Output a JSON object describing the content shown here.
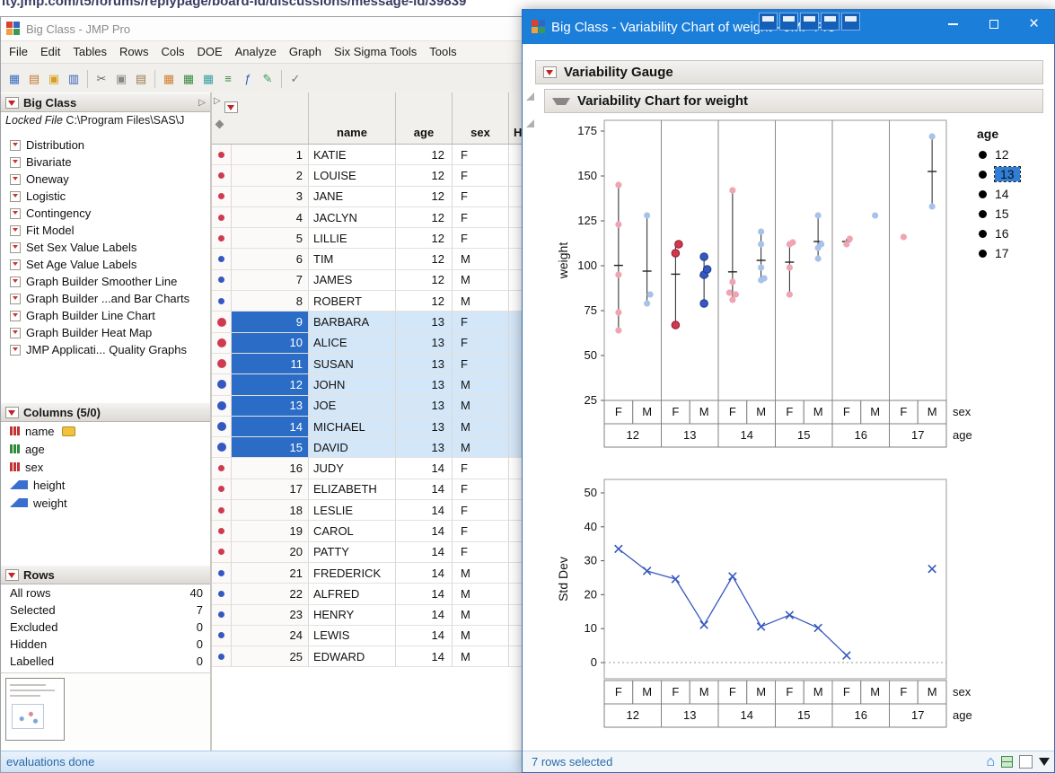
{
  "browser": {
    "url_text": "ity.jmp.com/t5/forums/replypage/board-id/discussions/message-id/39839"
  },
  "colors": {
    "titlebar": "#1b7ed9",
    "selection_blue": "#2a6cc6",
    "row_highlight": "#d4e7f8",
    "female": "#d2374d",
    "female_light": "#f0a4b2",
    "male": "#3558c0",
    "male_light": "#a8c2ea"
  },
  "main_window": {
    "title": "Big Class - JMP Pro",
    "menus": [
      "File",
      "Edit",
      "Tables",
      "Rows",
      "Cols",
      "DOE",
      "Analyze",
      "Graph",
      "Six Sigma Tools",
      "Tools"
    ],
    "toolbar_icons": [
      {
        "name": "new-data-table-icon",
        "glyph": "▦",
        "color": "#3a6fc0"
      },
      {
        "name": "new-journal-icon",
        "glyph": "▤",
        "color": "#c07a30"
      },
      {
        "name": "open-icon",
        "glyph": "▣",
        "color": "#d8a020"
      },
      {
        "name": "save-icon",
        "glyph": "▥",
        "color": "#2f5fb8"
      },
      {
        "sep": true
      },
      {
        "name": "cut-icon",
        "glyph": "✂",
        "color": "#666666"
      },
      {
        "name": "copy-icon",
        "glyph": "▣",
        "color": "#888888"
      },
      {
        "name": "paste-icon",
        "glyph": "▤",
        "color": "#9a7a50"
      },
      {
        "sep": true
      },
      {
        "name": "data-table-icon",
        "glyph": "▦",
        "color": "#d08030"
      },
      {
        "name": "summary-table-icon",
        "glyph": "▦",
        "color": "#3a8a40"
      },
      {
        "name": "graph-table-icon",
        "glyph": "▦",
        "color": "#3aa0a0"
      },
      {
        "name": "align-icon",
        "glyph": "≡",
        "color": "#3a8a40"
      },
      {
        "name": "formula-icon",
        "glyph": "ƒ",
        "color": "#2f5fb8"
      },
      {
        "name": "annotate-icon",
        "glyph": "✎",
        "color": "#3a9a50"
      },
      {
        "sep": true
      },
      {
        "name": "check-icon",
        "glyph": "✓",
        "color": "#777777"
      }
    ],
    "table_panel": {
      "title": "Big Class",
      "locked_label": "Locked File",
      "locked_path": "C:\\Program Files\\SAS\\J",
      "scripts": [
        "Distribution",
        "Bivariate",
        "Oneway",
        "Logistic",
        "Contingency",
        "Fit Model",
        "Set Sex Value Labels",
        "Set Age Value Labels",
        "Graph Builder Smoother Line",
        "Graph Builder ...and Bar Charts",
        "Graph Builder Line Chart",
        "Graph Builder Heat Map",
        "JMP Applicati... Quality Graphs"
      ]
    },
    "columns_panel": {
      "title": "Columns (5/0)",
      "columns": [
        {
          "name": "name",
          "type": "nominal",
          "labeled": true
        },
        {
          "name": "age",
          "type": "ordinal",
          "labeled": false
        },
        {
          "name": "sex",
          "type": "nominal",
          "labeled": false
        },
        {
          "name": "height",
          "type": "continuous",
          "labeled": false
        },
        {
          "name": "weight",
          "type": "continuous",
          "labeled": false
        }
      ]
    },
    "rows_panel": {
      "title": "Rows",
      "stats": [
        {
          "label": "All rows",
          "value": "40"
        },
        {
          "label": "Selected",
          "value": "7"
        },
        {
          "label": "Excluded",
          "value": "0"
        },
        {
          "label": "Hidden",
          "value": "0"
        },
        {
          "label": "Labelled",
          "value": "0"
        }
      ]
    },
    "grid": {
      "columns": [
        "name",
        "age",
        "sex"
      ],
      "partial_column": "H",
      "selected_rows": [
        9,
        10,
        11,
        12,
        13,
        14,
        15
      ],
      "rows": [
        {
          "n": 1,
          "name": "KATIE",
          "age": 12,
          "sex": "F"
        },
        {
          "n": 2,
          "name": "LOUISE",
          "age": 12,
          "sex": "F"
        },
        {
          "n": 3,
          "name": "JANE",
          "age": 12,
          "sex": "F"
        },
        {
          "n": 4,
          "name": "JACLYN",
          "age": 12,
          "sex": "F"
        },
        {
          "n": 5,
          "name": "LILLIE",
          "age": 12,
          "sex": "F"
        },
        {
          "n": 6,
          "name": "TIM",
          "age": 12,
          "sex": "M"
        },
        {
          "n": 7,
          "name": "JAMES",
          "age": 12,
          "sex": "M"
        },
        {
          "n": 8,
          "name": "ROBERT",
          "age": 12,
          "sex": "M"
        },
        {
          "n": 9,
          "name": "BARBARA",
          "age": 13,
          "sex": "F"
        },
        {
          "n": 10,
          "name": "ALICE",
          "age": 13,
          "sex": "F"
        },
        {
          "n": 11,
          "name": "SUSAN",
          "age": 13,
          "sex": "F"
        },
        {
          "n": 12,
          "name": "JOHN",
          "age": 13,
          "sex": "M"
        },
        {
          "n": 13,
          "name": "JOE",
          "age": 13,
          "sex": "M"
        },
        {
          "n": 14,
          "name": "MICHAEL",
          "age": 13,
          "sex": "M"
        },
        {
          "n": 15,
          "name": "DAVID",
          "age": 13,
          "sex": "M"
        },
        {
          "n": 16,
          "name": "JUDY",
          "age": 14,
          "sex": "F"
        },
        {
          "n": 17,
          "name": "ELIZABETH",
          "age": 14,
          "sex": "F"
        },
        {
          "n": 18,
          "name": "LESLIE",
          "age": 14,
          "sex": "F"
        },
        {
          "n": 19,
          "name": "CAROL",
          "age": 14,
          "sex": "F"
        },
        {
          "n": 20,
          "name": "PATTY",
          "age": 14,
          "sex": "F"
        },
        {
          "n": 21,
          "name": "FREDERICK",
          "age": 14,
          "sex": "M"
        },
        {
          "n": 22,
          "name": "ALFRED",
          "age": 14,
          "sex": "M"
        },
        {
          "n": 23,
          "name": "HENRY",
          "age": 14,
          "sex": "M"
        },
        {
          "n": 24,
          "name": "LEWIS",
          "age": 14,
          "sex": "M"
        },
        {
          "n": 25,
          "name": "EDWARD",
          "age": 14,
          "sex": "M"
        }
      ]
    },
    "status": "evaluations done"
  },
  "chart_window": {
    "title": "Big Class - Variability Chart of weight - JMP Pro",
    "section1": "Variability Gauge",
    "section2": "Variability Chart for weight",
    "float_buttons": [
      "",
      "",
      "",
      "",
      ""
    ],
    "legend": {
      "title": "age",
      "items": [
        "12",
        "13",
        "14",
        "15",
        "16",
        "17"
      ],
      "selected": "13"
    },
    "status": "7 rows selected"
  },
  "chart_data": [
    {
      "type": "variability",
      "ylabel": "weight",
      "ylim": [
        25,
        175
      ],
      "yticks": [
        25,
        50,
        75,
        100,
        125,
        150,
        175
      ],
      "row_labels": {
        "sex": "sex",
        "age": "age"
      },
      "groups": [
        {
          "age": "12",
          "sex": "F",
          "selected": false,
          "points": [
            64,
            74,
            95,
            123,
            145
          ],
          "mean": 100.2
        },
        {
          "age": "12",
          "sex": "M",
          "selected": false,
          "points": [
            79,
            84,
            128
          ],
          "mean": 97
        },
        {
          "age": "13",
          "sex": "F",
          "selected": true,
          "points": [
            67,
            107,
            112
          ],
          "mean": 95.3
        },
        {
          "age": "13",
          "sex": "M",
          "selected": true,
          "points": [
            79,
            95,
            98,
            105
          ],
          "mean": 94.3
        },
        {
          "age": "14",
          "sex": "F",
          "selected": false,
          "points": [
            81,
            84,
            85,
            91,
            142
          ],
          "mean": 96.6
        },
        {
          "age": "14",
          "sex": "M",
          "selected": false,
          "points": [
            92,
            93,
            99,
            112,
            119
          ],
          "mean": 103
        },
        {
          "age": "15",
          "sex": "F",
          "selected": false,
          "points": [
            84,
            99,
            112,
            113
          ],
          "mean": 102
        },
        {
          "age": "15",
          "sex": "M",
          "selected": false,
          "points": [
            104,
            110,
            112,
            128
          ],
          "mean": 113.5
        },
        {
          "age": "16",
          "sex": "F",
          "selected": false,
          "points": [
            112,
            115
          ],
          "mean": 113.5
        },
        {
          "age": "16",
          "sex": "M",
          "selected": false,
          "points": [
            128
          ],
          "mean": null
        },
        {
          "age": "17",
          "sex": "F",
          "selected": false,
          "points": [
            116
          ],
          "mean": null
        },
        {
          "age": "17",
          "sex": "M",
          "selected": false,
          "points": [
            133,
            172
          ],
          "mean": 152.5
        }
      ]
    },
    {
      "type": "line",
      "ylabel": "Std Dev",
      "ylim": [
        0,
        50
      ],
      "yticks": [
        0,
        10,
        20,
        30,
        40,
        50
      ],
      "values": [
        33.5,
        27,
        24.6,
        11.1,
        25.4,
        10.6,
        14,
        10.2,
        2.1,
        null,
        null,
        27.6
      ]
    }
  ]
}
